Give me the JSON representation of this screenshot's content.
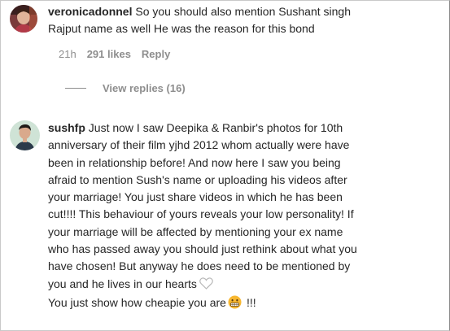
{
  "comments": [
    {
      "username": "veronicadonnel",
      "text": "So you should also mention Sushant singh\nRajput name as well He was the reason for this bond",
      "time": "21h",
      "likes": "291 likes",
      "reply_label": "Reply",
      "view_replies": "View replies (16)"
    },
    {
      "username": "sushfp",
      "text": "Just now I saw Deepika & Ranbir's photos for 10th\nanniversary of their film yjhd 2012 whom actually were have\nbeen in relationship before! And now here I saw you being\nafraid to mention Sush's name or uploading his videos after\nyour marriage! You just share videos in which he has been\ncut!!!! This behaviour of yours reveals your low personality! If\nyour marriage will be affected by mentioning your ex name\nwho has passed away you should just rethink about what you\nhave chosen! But anyway he does need to be mentioned by\nyou and he lives in our hearts",
      "text_last_line": "You just show how cheapie you are",
      "text_suffix": "!!!",
      "icons": [
        "heart-icon",
        "grimacing-face-emoji"
      ]
    }
  ],
  "colors": {
    "text": "#262626",
    "secondary": "#8e8e8e",
    "background": "#ffffff"
  }
}
